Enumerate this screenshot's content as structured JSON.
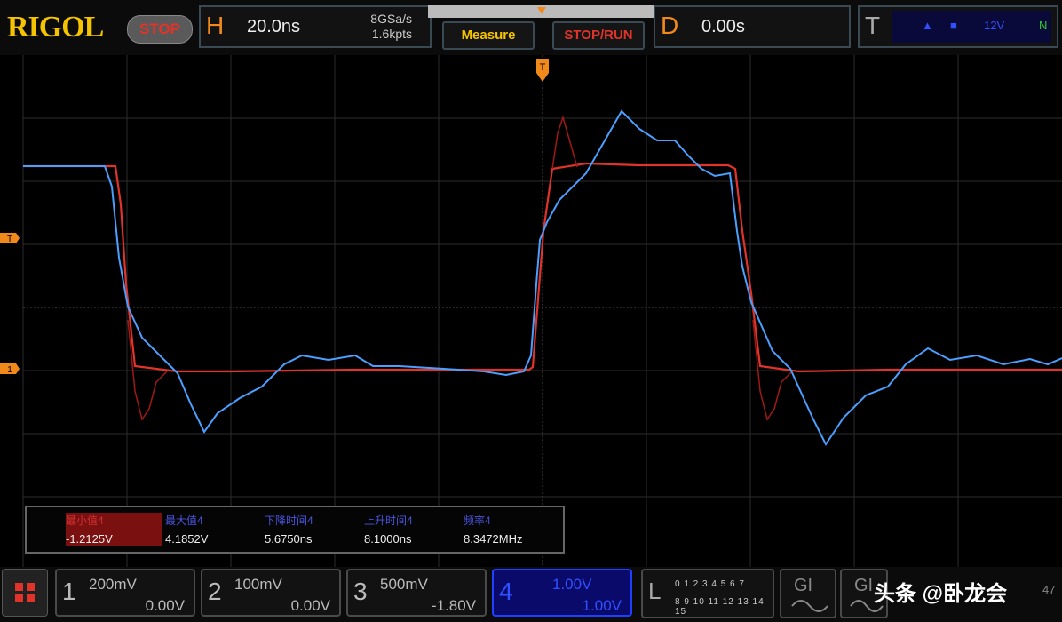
{
  "brand": "RIGOL",
  "run_state": "STOP",
  "horizontal": {
    "key": "H",
    "timebase": "20.0ns",
    "sample_rate": "8GSa/s",
    "mem_depth": "1.6kpts"
  },
  "buttons": {
    "measure": "Measure",
    "stop_run": "STOP/RUN"
  },
  "delay": {
    "key": "D",
    "value": "0.00s"
  },
  "trigger": {
    "key": "T",
    "level": "12V",
    "mode": "N"
  },
  "markers": {
    "trigger_level": "T",
    "ch1": "1",
    "trigger_pos": "T"
  },
  "measurements": [
    {
      "label": "最小值4",
      "value": "-1.2125V",
      "selected": true
    },
    {
      "label": "最大值4",
      "value": "4.1852V",
      "selected": false
    },
    {
      "label": "下降时间4",
      "value": "5.6750ns",
      "selected": false
    },
    {
      "label": "上升时间4",
      "value": "8.1000ns",
      "selected": false
    },
    {
      "label": "频率4",
      "value": "8.3472MHz",
      "selected": false
    }
  ],
  "channels": [
    {
      "num": "1",
      "scale": "200mV",
      "offset": "0.00V"
    },
    {
      "num": "2",
      "scale": "100mV",
      "offset": "0.00V"
    },
    {
      "num": "3",
      "scale": "500mV",
      "offset": "-1.80V"
    },
    {
      "num": "4",
      "scale": "1.00V",
      "offset": "1.00V"
    }
  ],
  "logic": {
    "key": "L",
    "row1": "0 1 2 3 4 5 6 7",
    "row2": "8 9 10 11 12 13 14 15"
  },
  "gen": [
    {
      "label": "GI"
    },
    {
      "label": "GI"
    }
  ],
  "watermark": {
    "text": "头条 @卧龙会",
    "suffix": "47"
  },
  "colors": {
    "accent": "#f28a1b",
    "trace_red": "#e0332a",
    "trace_blue": "#4a9fff"
  }
}
